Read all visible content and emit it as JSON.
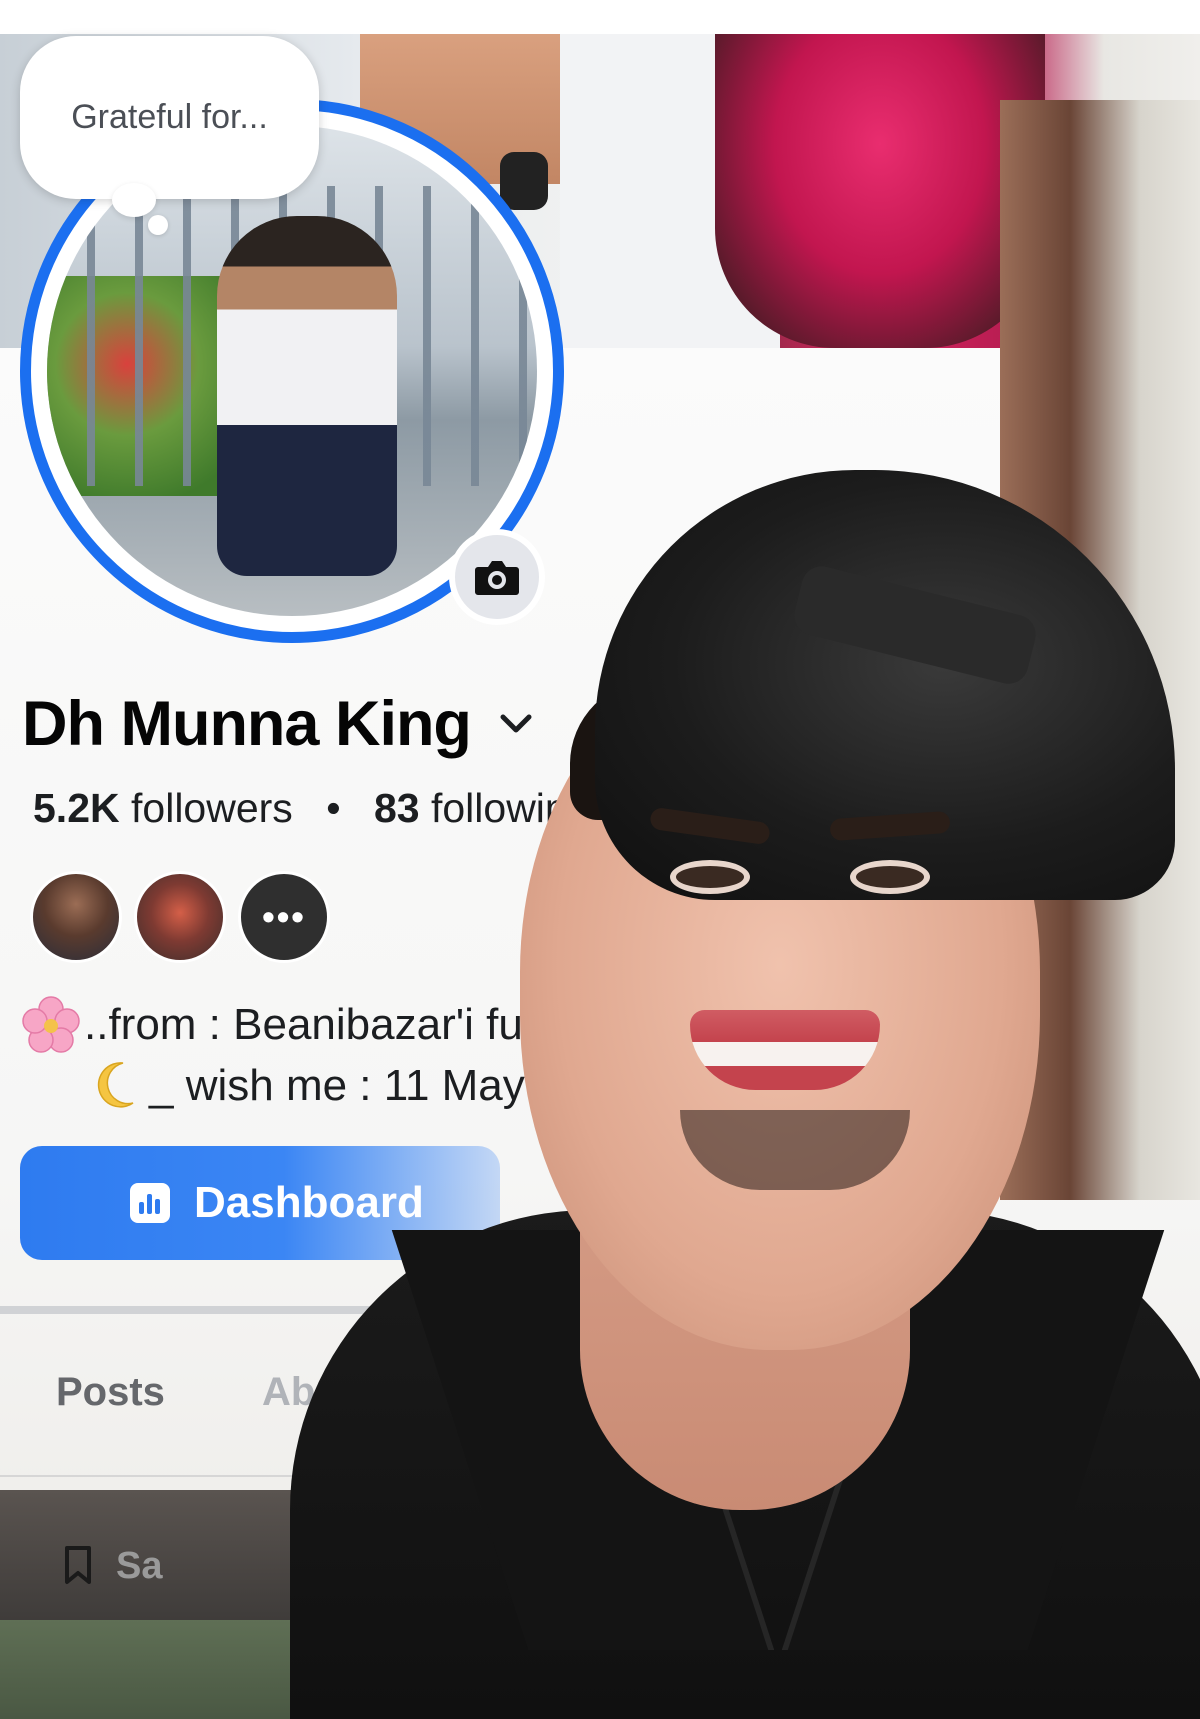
{
  "status_bubble": {
    "text": "Grateful for..."
  },
  "profile": {
    "name": "Dh Munna King",
    "followers_count": "5.2K",
    "followers_label": "followers",
    "separator": "•",
    "following_count": "83",
    "following_label": "followin"
  },
  "friends": {
    "more_label": "•••"
  },
  "bio": {
    "line1_emoji": "cherry-blossom",
    "line1": "..from : Beanibazar'i fua",
    "line2_emoji": "crescent-moon",
    "line2": "_ wish me : 11 May"
  },
  "dashboard_button": {
    "label": "Dashboard"
  },
  "tabs": {
    "posts": "Posts",
    "about": "Abou"
  },
  "saved": {
    "label": "Sa"
  },
  "colors": {
    "accent": "#1b6ff0",
    "button": "#2e7bf0",
    "notification_dot": "#e46a6a"
  },
  "icons": {
    "cover_camera": "camera-icon",
    "avatar_camera": "camera-icon",
    "name_chevron": "chevron-down-icon",
    "dashboard": "bar-chart-icon",
    "saved": "bookmark-icon"
  }
}
